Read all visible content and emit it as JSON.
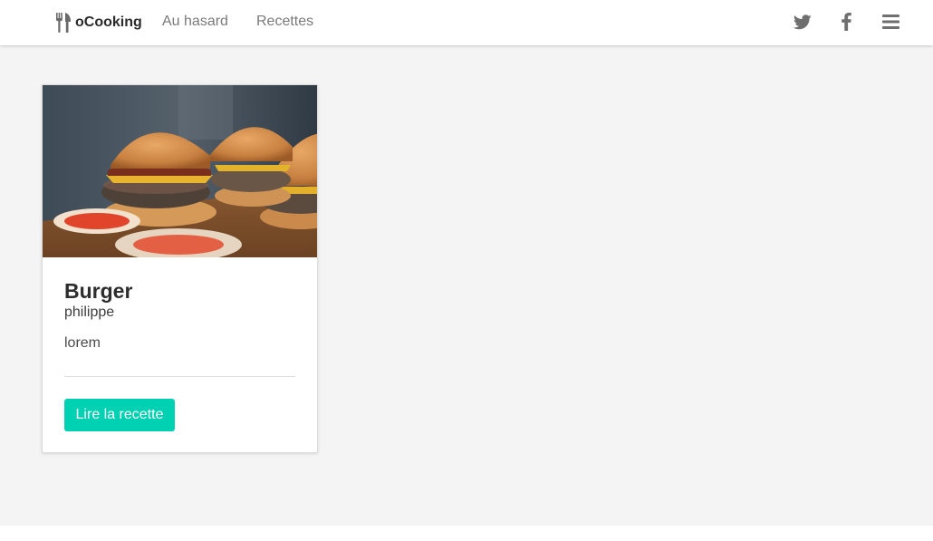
{
  "nav": {
    "brand": "oCooking",
    "brand_icon": "utensils-icon",
    "links": [
      "Au hasard",
      "Recettes"
    ],
    "right_icons": [
      "twitter-icon",
      "facebook-icon",
      "menu-icon"
    ]
  },
  "recipe_card": {
    "image": "burger-photo",
    "title": "Burger",
    "author": "philippe",
    "description": "lorem",
    "button_label": "Lire la recette"
  },
  "colors": {
    "accent": "#00d1b2",
    "page_background": "#f4f4f4",
    "nav_text": "#7a7a7a"
  }
}
